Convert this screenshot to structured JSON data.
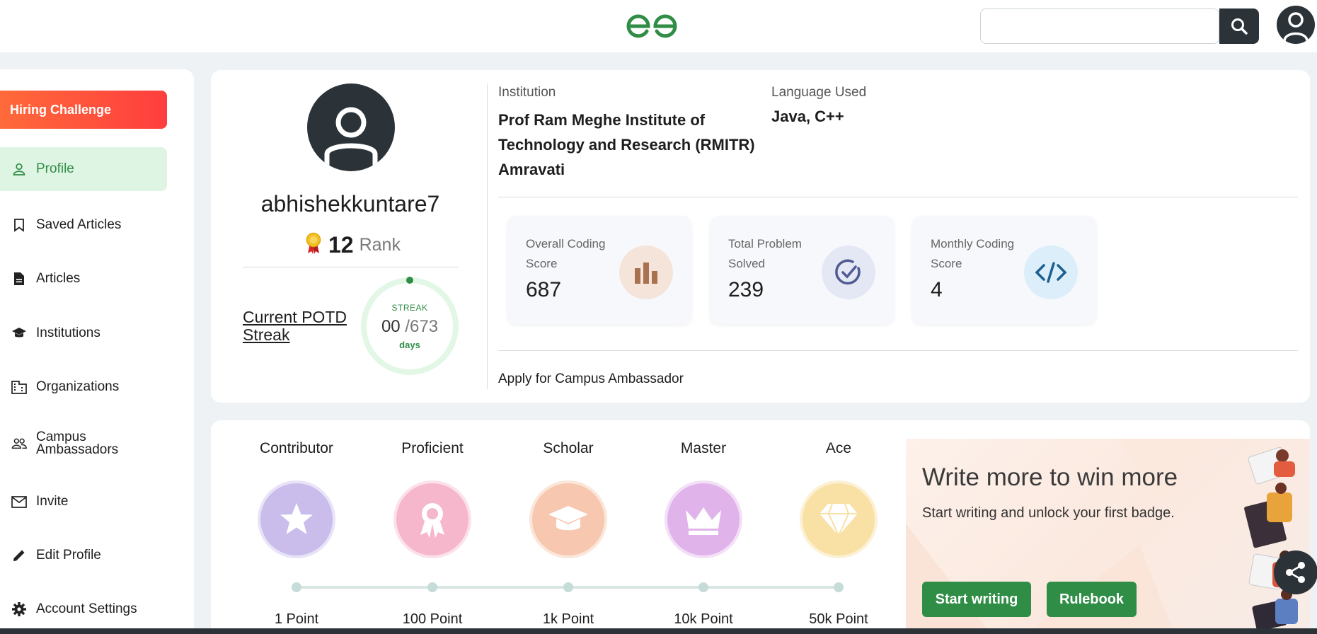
{
  "header": {
    "logo_icon": "gfg-logo-icon",
    "search": {
      "placeholder": "",
      "value": ""
    },
    "search_icon": "search-icon",
    "avatar_icon": "user-avatar-icon"
  },
  "sidebar": {
    "hiring_label": "Hiring Challenge",
    "items": [
      {
        "label": "Profile",
        "icon": "user-icon",
        "active": true
      },
      {
        "label": "Saved Articles",
        "icon": "bookmark-icon"
      },
      {
        "label": "Articles",
        "icon": "document-icon"
      },
      {
        "label": "Institutions",
        "icon": "graduation-cap-icon"
      },
      {
        "label": "Organizations",
        "icon": "building-icon"
      },
      {
        "label": "Campus Ambassadors",
        "icon": "group-icon"
      },
      {
        "label": "Invite",
        "icon": "envelope-icon"
      },
      {
        "label": "Edit Profile",
        "icon": "pencil-icon"
      },
      {
        "label": "Account Settings",
        "icon": "gear-icon"
      }
    ]
  },
  "profile": {
    "username": "abhishekkuntare7",
    "rank": "12",
    "rank_label": "Rank",
    "potd_label": "Current POTD Streak",
    "streak": {
      "label": "STREAK",
      "current": "00",
      "total": "/673",
      "unit": "days",
      "fraction": 0.0
    },
    "institution_label": "Institution",
    "institution": "Prof Ram Meghe Institute of Technology and Research (RMITR) Amravati",
    "language_label": "Language Used",
    "languages": "Java, C++",
    "apply_link": "Apply for Campus Ambassador"
  },
  "stats": [
    {
      "label": "Overall Coding Score",
      "value": "687",
      "icon": "bar-chart-icon",
      "color": "#a8714f"
    },
    {
      "label": "Total Problem Solved",
      "value": "239",
      "icon": "check-circle-icon",
      "color": "#4f5b93"
    },
    {
      "label": "Monthly Coding Score",
      "value": "4",
      "icon": "code-icon",
      "color": "#1c5f8f"
    }
  ],
  "badges": [
    {
      "title": "Contributor",
      "points": "1 Point",
      "icon": "star-icon",
      "color": "#b7a4e6"
    },
    {
      "title": "Proficient",
      "points": "100 Point",
      "icon": "ribbon-icon",
      "color": "#f39bb7"
    },
    {
      "title": "Scholar",
      "points": "1k Point",
      "icon": "graduation-cap-icon",
      "color": "#f5b08e"
    },
    {
      "title": "Master",
      "points": "10k Point",
      "icon": "crown-icon",
      "color": "#d69be4"
    },
    {
      "title": "Ace",
      "points": "50k Point",
      "icon": "diamond-icon",
      "color": "#f7d78a"
    }
  ],
  "promo": {
    "title": "Write more to win more",
    "subtitle": "Start writing and unlock your first badge.",
    "start_label": "Start writing",
    "rulebook_label": "Rulebook"
  },
  "colors": {
    "brand_green": "#2f8d46",
    "dark": "#2b3338",
    "hiring_orange": "#ff5a3c"
  }
}
